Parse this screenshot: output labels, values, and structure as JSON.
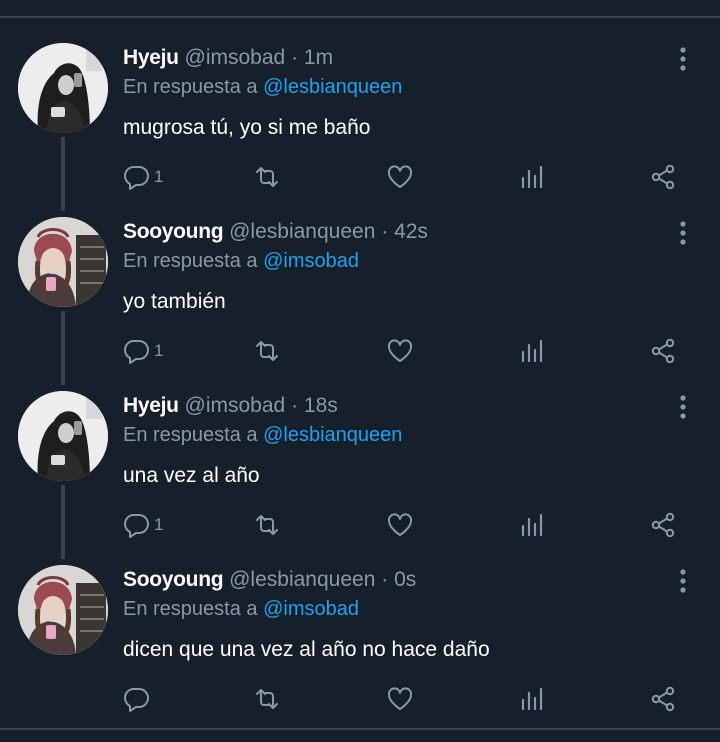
{
  "tweets": [
    {
      "name": "Hyeju",
      "handle": "@imsobad",
      "time": "1m",
      "reply_prefix": "En respuesta a",
      "reply_to": "@lesbianqueen",
      "text": "mugrosa tú, yo si me baño",
      "replies": "1",
      "avatar": "avatar-hyeju"
    },
    {
      "name": "Sooyoung",
      "handle": "@lesbianqueen",
      "time": "42s",
      "reply_prefix": "En respuesta a",
      "reply_to": "@imsobad",
      "text": "yo también",
      "replies": "1",
      "avatar": "avatar-sooyoung"
    },
    {
      "name": "Hyeju",
      "handle": "@imsobad",
      "time": "18s",
      "reply_prefix": "En respuesta a",
      "reply_to": "@lesbianqueen",
      "text": "una vez al año",
      "replies": "1",
      "avatar": "avatar-hyeju"
    },
    {
      "name": "Sooyoung",
      "handle": "@lesbianqueen",
      "time": "0s",
      "reply_prefix": "En respuesta a",
      "reply_to": "@imsobad",
      "text": "dicen que una vez al año no hace daño",
      "replies": "",
      "avatar": "avatar-sooyoung"
    }
  ],
  "sep": "·",
  "icons": [
    "reply-icon",
    "retweet-icon",
    "like-icon",
    "analytics-icon",
    "share-icon",
    "more-icon"
  ],
  "colors": {
    "background": "#15202b",
    "text": "#ffffff",
    "secondary": "#8899a6",
    "link": "#1da1f2",
    "divider": "#38444d"
  }
}
